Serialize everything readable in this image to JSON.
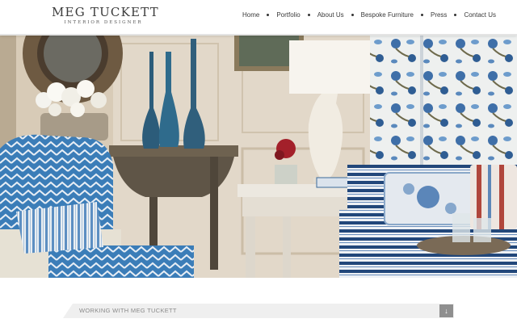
{
  "brand": {
    "name": "MEG TUCKETT",
    "tagline": "INTERIOR DESIGNER"
  },
  "nav": {
    "items": [
      {
        "label": "Home"
      },
      {
        "label": "Portfolio"
      },
      {
        "label": "About Us"
      },
      {
        "label": "Bespoke Furniture"
      },
      {
        "label": "Press"
      },
      {
        "label": "Contact Us"
      }
    ]
  },
  "hero": {
    "image": "interior-living-room-photo"
  },
  "section_bar": {
    "title": "WORKING WITH MEG TUCKETT",
    "icon": "arrow-down-icon"
  },
  "colors": {
    "text": "#3a3a3a",
    "bar": "#efefef",
    "button": "#8f8f8f"
  }
}
